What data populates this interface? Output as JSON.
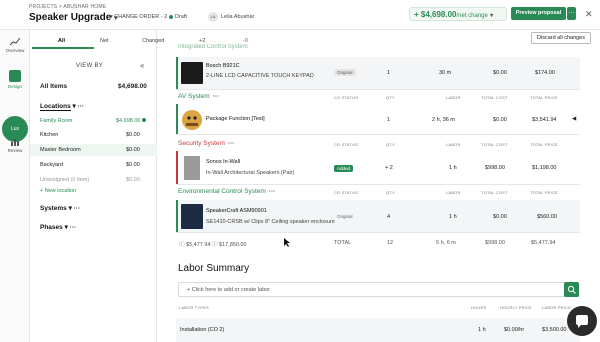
{
  "header": {
    "breadcrumb": "PROJECTS > ABUSHAR HOME",
    "title": "Speaker Upgrade",
    "change_order": "CHANGE ORDER - 2",
    "status": "Draft",
    "avatar_initials": "LA",
    "user_name": "Leila Abushar",
    "net_change_value": "+ $4,698.00",
    "net_change_label": "/net change",
    "preview_label": "Preview proposal",
    "more_label": "…",
    "close_label": "✕",
    "accent_color": "#2a8a55"
  },
  "rail": {
    "items": [
      {
        "label": "Overview",
        "icon": "chart-icon"
      },
      {
        "label": "Design",
        "icon": "design-icon"
      },
      {
        "label": "Lux",
        "icon": "lux-icon"
      },
      {
        "label": "Review",
        "icon": "review-icon"
      }
    ]
  },
  "panel": {
    "view_by": "VIEW BY",
    "all_items_label": "All Items",
    "all_items_value": "$4,698.00",
    "locations_label": "Locations",
    "locations": [
      {
        "name": "Family Room",
        "value": "$4,698.00"
      },
      {
        "name": "Kitchen",
        "value": "$0.00"
      },
      {
        "name": "Master Bedroom",
        "value": "$0.00"
      },
      {
        "name": "Backyard",
        "value": "$0.00"
      },
      {
        "name": "Unassigned (0 item)",
        "value": "$0.00"
      }
    ],
    "new_location": "+ New location",
    "systems_label": "Systems",
    "phases_label": "Phases"
  },
  "tabs": [
    {
      "label": "All"
    },
    {
      "label": "Net"
    },
    {
      "label": "Changed"
    },
    {
      "label": "+2"
    },
    {
      "label": "-0"
    }
  ],
  "discard_label": "Discard all changes",
  "groups": {
    "integrated": {
      "name": "Integrated Control System"
    },
    "av": {
      "name": "AV System"
    },
    "security": {
      "name": "Security System"
    },
    "environmental": {
      "name": "Environmental Control System"
    }
  },
  "columns": {
    "co_status": "CO STATUS",
    "qty": "QTY",
    "labor": "LABOR",
    "total_cost": "TOTAL COST",
    "total_price": "TOTAL PRICE"
  },
  "rows": [
    {
      "name": "Bosch B921C",
      "desc": "2-LINE LCD CAPACITIVE TOUCH KEYPAD",
      "status": "Original",
      "qty": "1",
      "labor": "30 m",
      "cost": "$0.00",
      "price": "$174.00"
    },
    {
      "name": "Package Function [Test]",
      "desc": "",
      "status": "Original",
      "qty": "1",
      "labor": "2 h, 36 m",
      "cost": "$0.00",
      "price": "$3,541.94"
    },
    {
      "name": "Sonos In-Wall",
      "desc": "In-Wall Architectural Speakers (Pair)",
      "status": "Added",
      "qty": "+ 2",
      "labor": "1 h",
      "cost": "$998.00",
      "price": "$1,198.00"
    },
    {
      "name": "SpeakerCraft ASM90901",
      "desc": "SE1410-CRSB w/ Clips 8\" Ceiling speaker enclosure",
      "status": "Original",
      "qty": "4",
      "labor": "1 h",
      "cost": "$0.00",
      "price": "$560.00"
    }
  ],
  "totals": {
    "cost_a": "$5,477.94",
    "cost_b": "$17,850.00",
    "label": "TOTAL",
    "qty": "12",
    "labor": "5 h, 6 m",
    "cost": "$998.00",
    "price": "$5,477.94"
  },
  "labor": {
    "title": "Labor Summary",
    "search_placeholder": "Click here to add or create labor",
    "col_type": "LABOR TYPES",
    "col_hours": "HOURS",
    "col_rate": "HOURLY PRICE",
    "col_price": "LABOR PRICE",
    "row_name": "Installation (CO 2)",
    "row_hours": "1 h",
    "row_rate": "$0.00/hr",
    "row_price": "$3,500.00"
  }
}
